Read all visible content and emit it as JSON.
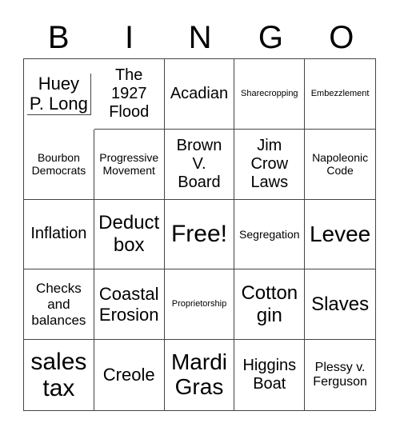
{
  "header": [
    "B",
    "I",
    "N",
    "G",
    "O"
  ],
  "cells": [
    "Huey P. Long",
    "The 1927 Flood",
    "Acadian",
    "Sharecropping",
    "Embezzlement",
    "Bourbon Democrats",
    "Progressive Movement",
    "Brown V. Board",
    "Jim Crow Laws",
    "Napoleonic Code",
    "Inflation",
    "Deduct box",
    "Free!",
    "Segregation",
    "Levee",
    "Checks and balances",
    "Coastal Erosion",
    "Proprietorship",
    "Cotton gin",
    "Slaves",
    "sales tax",
    "Creole",
    "Mardi Gras",
    "Higgins Boat",
    "Plessy v. Ferguson"
  ]
}
